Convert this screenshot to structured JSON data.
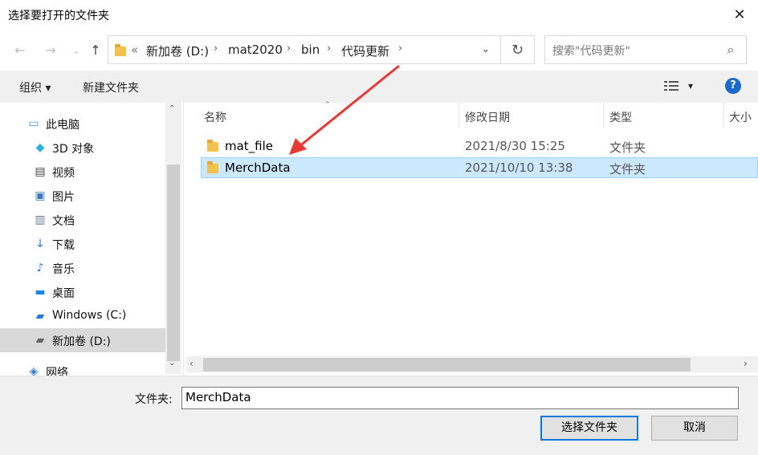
{
  "window": {
    "title": "选择要打开的文件夹"
  },
  "nav": {
    "back": "←",
    "forward": "→",
    "recent": "⌄",
    "up": "↑"
  },
  "address": {
    "overflow": "«",
    "crumbs": [
      "新加卷 (D:)",
      "mat2020",
      "bin",
      "代码更新"
    ]
  },
  "search": {
    "placeholder": "搜索\"代码更新\""
  },
  "toolbar": {
    "organize": "组织 ▾",
    "new_folder": "新建文件夹",
    "view": "▾",
    "help": "?"
  },
  "sidebar": {
    "items": [
      {
        "label": "此电脑",
        "icon": "computer-icon"
      },
      {
        "label": "3D 对象",
        "icon": "3d-objects-icon"
      },
      {
        "label": "视频",
        "icon": "video-icon"
      },
      {
        "label": "图片",
        "icon": "pictures-icon"
      },
      {
        "label": "文档",
        "icon": "documents-icon"
      },
      {
        "label": "下载",
        "icon": "download-icon"
      },
      {
        "label": "音乐",
        "icon": "music-icon"
      },
      {
        "label": "桌面",
        "icon": "desktop-icon"
      },
      {
        "label": "Windows (C:)",
        "icon": "drive-c-icon"
      },
      {
        "label": "新加卷 (D:)",
        "icon": "drive-d-icon",
        "selected": true
      },
      {
        "label": "网络",
        "icon": "network-icon"
      }
    ]
  },
  "columns": {
    "name": "名称",
    "modified": "修改日期",
    "type": "类型",
    "size": "大小"
  },
  "files": [
    {
      "name": "mat_file",
      "modified": "2021/8/30 15:25",
      "type": "文件夹",
      "selected": false
    },
    {
      "name": "MerchData",
      "modified": "2021/10/10 13:38",
      "type": "文件夹",
      "selected": true
    }
  ],
  "footer": {
    "folder_label": "文件夹:",
    "folder_value": "MerchData",
    "select_button": "选择文件夹",
    "cancel_button": "取消"
  },
  "colors": {
    "accent": "#0078d7",
    "selection": "#cce8ff",
    "annotation_arrow": "#e53935"
  }
}
